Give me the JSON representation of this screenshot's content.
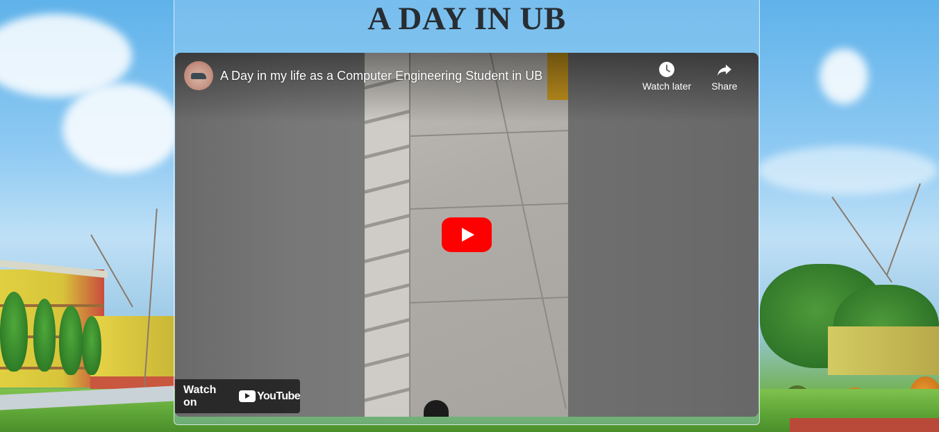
{
  "page": {
    "title": "A DAY IN UB"
  },
  "video": {
    "title": "A Day in my life as a Computer Engineering Student in UB",
    "channel_avatar_icon": "channel-avatar",
    "play_icon": "play-icon",
    "controls": {
      "watch_later": {
        "label": "Watch later",
        "icon": "clock-icon"
      },
      "share": {
        "label": "Share",
        "icon": "share-arrow-icon"
      }
    },
    "watch_on": {
      "label": "Watch on",
      "brand": "YouTube"
    }
  },
  "colors": {
    "title_text": "#272d33",
    "play_button": "#ff0000",
    "player_bg": "#6c6c6c",
    "watch_on_bg": "#212121"
  }
}
